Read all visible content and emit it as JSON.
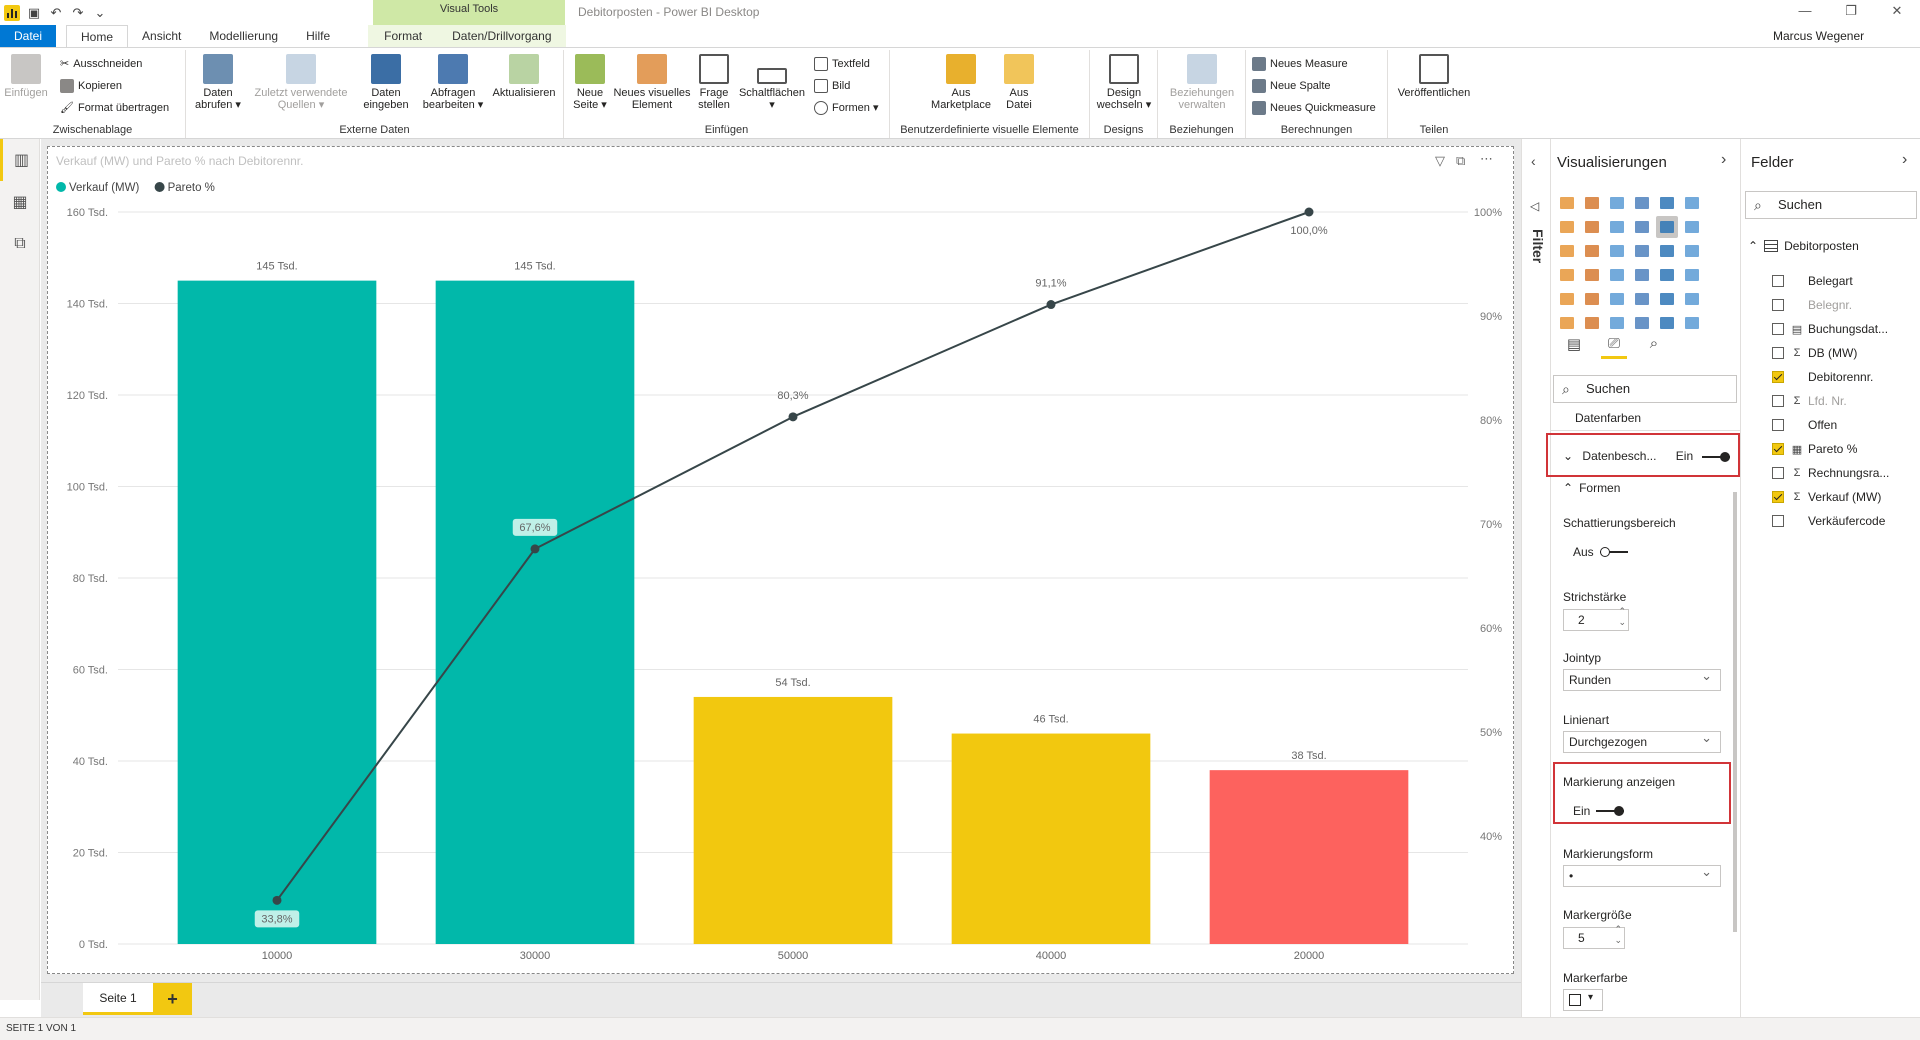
{
  "window": {
    "title": "Debitorposten - Power BI Desktop",
    "user": "Marcus Wegener",
    "context_tab_group": "Visual Tools"
  },
  "tabs": [
    "Datei",
    "Home",
    "Ansicht",
    "Modellierung",
    "Hilfe",
    "Format",
    "Daten/Drillvorgang"
  ],
  "ribbon": {
    "zwischenablage": {
      "title": "Zwischenablage",
      "einfuegen": "Einfügen",
      "ausschneiden": "Ausschneiden",
      "kopieren": "Kopieren",
      "format_uebertragen": "Format übertragen"
    },
    "externe_daten": {
      "title": "Externe Daten",
      "daten_abrufen": "Daten\nabrufen ▾",
      "zuletzt": "Zuletzt verwendete\nQuellen ▾",
      "daten_eingeben": "Daten\neingeben",
      "abfragen": "Abfragen\nbearbeiten ▾",
      "aktualisieren": "Aktualisieren"
    },
    "einfuegen": {
      "title": "Einfügen",
      "neue_seite": "Neue\nSeite ▾",
      "neues_visual": "Neues visuelles\nElement",
      "frage": "Frage\nstellen",
      "schaltflaechen": "Schaltflächen\n▾",
      "textfeld": "Textfeld",
      "bild": "Bild",
      "formen": "Formen ▾"
    },
    "benutzerdef": {
      "title": "Benutzerdefinierte visuelle Elemente",
      "marketplace": "Aus\nMarketplace",
      "datei": "Aus\nDatei"
    },
    "designs": {
      "title": "Designs",
      "design": "Design\nwechseln ▾"
    },
    "beziehungen": {
      "title": "Beziehungen",
      "verwalten": "Beziehungen\nverwalten"
    },
    "berechnungen": {
      "title": "Berechnungen",
      "measure": "Neues Measure",
      "spalte": "Neue Spalte",
      "quick": "Neues Quickmeasure"
    },
    "teilen": {
      "title": "Teilen",
      "veroeffentlichen": "Veröffentlichen"
    }
  },
  "pages": {
    "page1": "Seite 1",
    "add": "+"
  },
  "status": "SEITE 1 VON 1",
  "filter_label": "Filter",
  "viz_pane": {
    "title": "Visualisierungen",
    "search_placeholder": "Suchen",
    "sections": {
      "datenfarben": "Datenfarben",
      "datenbeschriftung": "Datenbesch...",
      "datenbeschriftung_value": "Ein",
      "formen": "Formen",
      "schattierung": "Schattierungsbereich",
      "schattierung_value": "Aus",
      "strichstaerke": "Strichstärke",
      "strichstaerke_value": "2",
      "jointyp": "Jointyp",
      "jointyp_value": "Runden",
      "linienart": "Linienart",
      "linienart_value": "Durchgezogen",
      "markierung": "Markierung anzeigen",
      "markierung_value": "Ein",
      "markierungsform": "Markierungsform",
      "markierungsform_value": "•",
      "markergroesse": "Markergröße",
      "markergroesse_value": "5",
      "markerfarbe": "Markerfarbe"
    }
  },
  "fields_pane": {
    "title": "Felder",
    "search_placeholder": "Suchen",
    "table": "Debitorposten",
    "fields": [
      {
        "name": "Belegart",
        "checked": false,
        "icon": "",
        "disabled": false
      },
      {
        "name": "Belegnr.",
        "checked": false,
        "icon": "",
        "disabled": true
      },
      {
        "name": "Buchungsdat...",
        "checked": false,
        "icon": "calendar",
        "disabled": false
      },
      {
        "name": "DB (MW)",
        "checked": false,
        "icon": "sigma",
        "disabled": false
      },
      {
        "name": "Debitorennr.",
        "checked": true,
        "icon": "",
        "disabled": false
      },
      {
        "name": "Lfd. Nr.",
        "checked": false,
        "icon": "sigma",
        "disabled": true
      },
      {
        "name": "Offen",
        "checked": false,
        "icon": "",
        "disabled": false
      },
      {
        "name": "Pareto %",
        "checked": true,
        "icon": "calc",
        "disabled": false
      },
      {
        "name": "Rechnungsra...",
        "checked": false,
        "icon": "sigma",
        "disabled": false
      },
      {
        "name": "Verkauf (MW)",
        "checked": true,
        "icon": "sigma",
        "disabled": false
      },
      {
        "name": "Verkäufercode",
        "checked": false,
        "icon": "",
        "disabled": false
      }
    ]
  },
  "chart_data": {
    "type": "bar",
    "title": "Verkauf (MW) und Pareto % nach Debitorennr.",
    "categories": [
      "10000",
      "30000",
      "50000",
      "40000",
      "20000"
    ],
    "series": [
      {
        "name": "Verkauf (MW)",
        "values": [
          145,
          145,
          54,
          46,
          38
        ],
        "labels": [
          "145 Tsd.",
          "145 Tsd.",
          "54 Tsd.",
          "46 Tsd.",
          "38 Tsd."
        ],
        "colors": [
          "#01b8aa",
          "#01b8aa",
          "#f2c80f",
          "#f2c80f",
          "#fd625e"
        ],
        "legend_color": "#01b8aa",
        "axis": "left"
      },
      {
        "name": "Pareto %",
        "type": "line",
        "values": [
          33.8,
          67.6,
          80.3,
          91.1,
          100.0
        ],
        "labels": [
          "33,8%",
          "67,6%",
          "80,3%",
          "91,1%",
          "100,0%"
        ],
        "color": "#374649",
        "axis": "right"
      }
    ],
    "y_left": {
      "ticks": [
        0,
        20,
        40,
        60,
        80,
        100,
        120,
        140,
        160
      ],
      "tick_labels": [
        "0 Tsd.",
        "20 Tsd.",
        "40 Tsd.",
        "60 Tsd.",
        "80 Tsd.",
        "100 Tsd.",
        "120 Tsd.",
        "140 Tsd.",
        "160 Tsd."
      ],
      "ylim": [
        0,
        160
      ]
    },
    "y_right": {
      "ticks": [
        40,
        50,
        60,
        70,
        80,
        90,
        100
      ],
      "tick_labels": [
        "40%",
        "50%",
        "60%",
        "70%",
        "80%",
        "90%",
        "100%"
      ],
      "ylim": [
        29.6,
        100
      ]
    },
    "legend_position": "top-left",
    "grid": true
  }
}
